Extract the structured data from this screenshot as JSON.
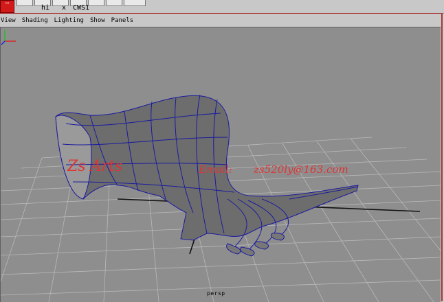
{
  "shelf": {
    "labels": [
      "hi",
      "x",
      "CWS1"
    ]
  },
  "menubar": {
    "items": [
      "View",
      "Shading",
      "Lighting",
      "Show",
      "Panels"
    ]
  },
  "viewport": {
    "camera": "persp",
    "watermark": {
      "part1": "Zs Arts",
      "part2": "Email:",
      "part3": "zs520ly@163.com"
    }
  },
  "icons": [
    "shelf-tool-icon",
    "axis-gizmo-icon"
  ]
}
